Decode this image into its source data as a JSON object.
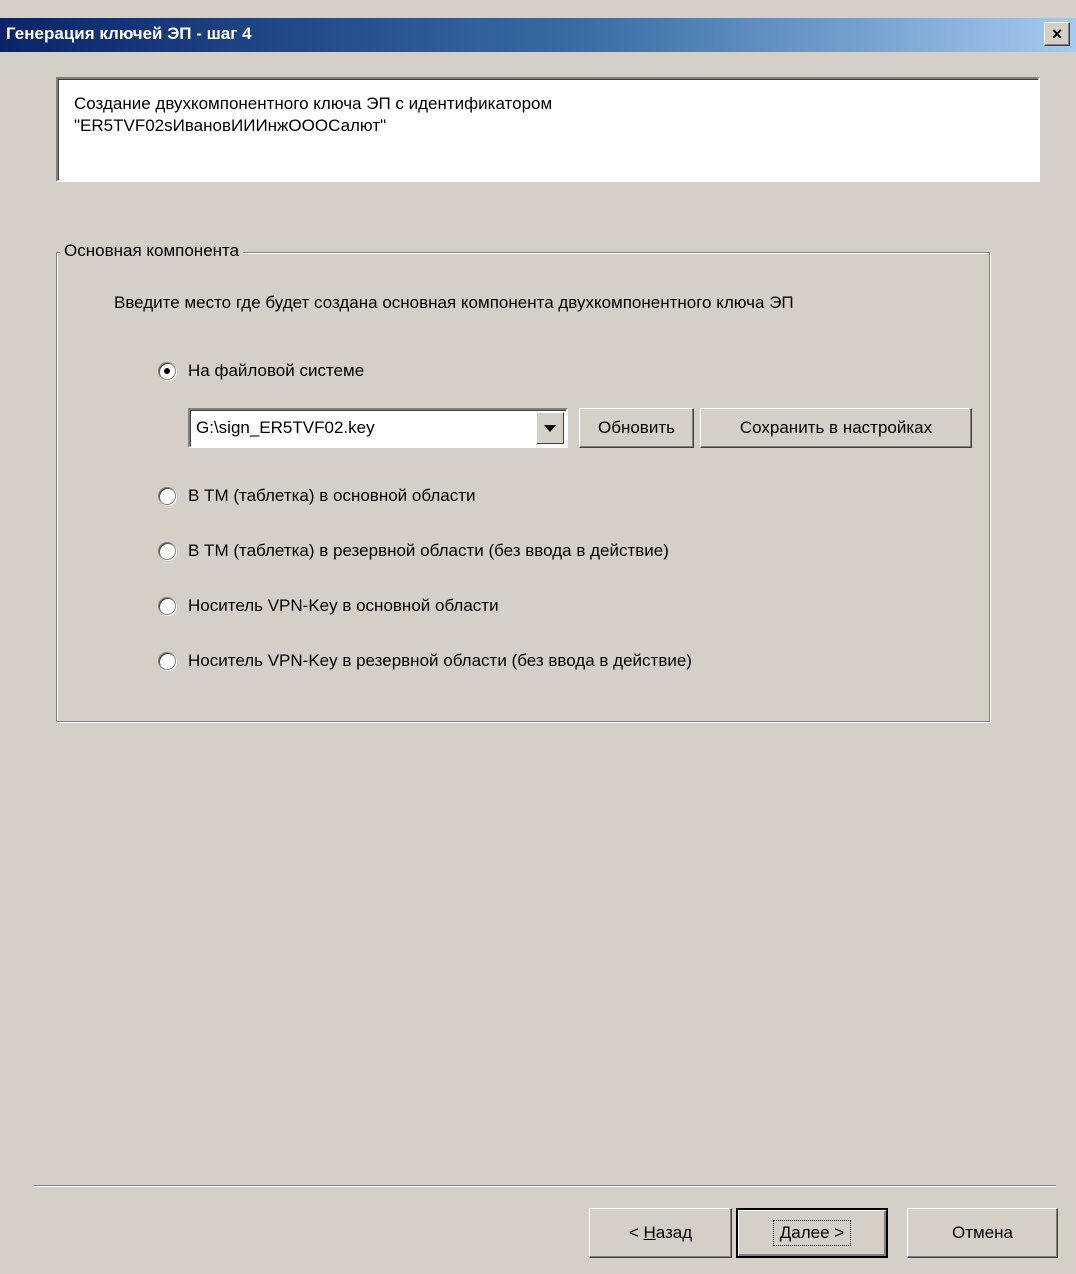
{
  "window": {
    "title": "Генерация ключей ЭП - шаг 4",
    "close_label": "×"
  },
  "description": {
    "line1": "Создание двухкомпонентного ключа ЭП с идентификатором",
    "line2": "\"ER5TVF02sИвановИИИнжОООСалют\""
  },
  "group": {
    "label": "Основная компонента",
    "instruction": "Введите место где будет создана основная компонента двухкомпонентного ключа ЭП"
  },
  "options": [
    {
      "label": "На файловой системе",
      "checked": true
    },
    {
      "label": "В ТМ (таблетка) в основной области",
      "checked": false
    },
    {
      "label": "В ТМ (таблетка) в резервной области (без ввода в действие)",
      "checked": false
    },
    {
      "label": "Носитель VPN-Key в основной области",
      "checked": false
    },
    {
      "label": "Носитель VPN-Key в резервной области (без ввода в действие)",
      "checked": false
    }
  ],
  "path_combo": {
    "value": "G:\\sign_ER5TVF02.key"
  },
  "buttons": {
    "refresh": "Обновить",
    "save_settings": "Сохранить в настройках",
    "back_prefix": "< ",
    "back_mnemonic": "Н",
    "back_rest": "азад",
    "next_mnemonic": "Д",
    "next_rest": "алее >",
    "cancel": "Отмена"
  }
}
